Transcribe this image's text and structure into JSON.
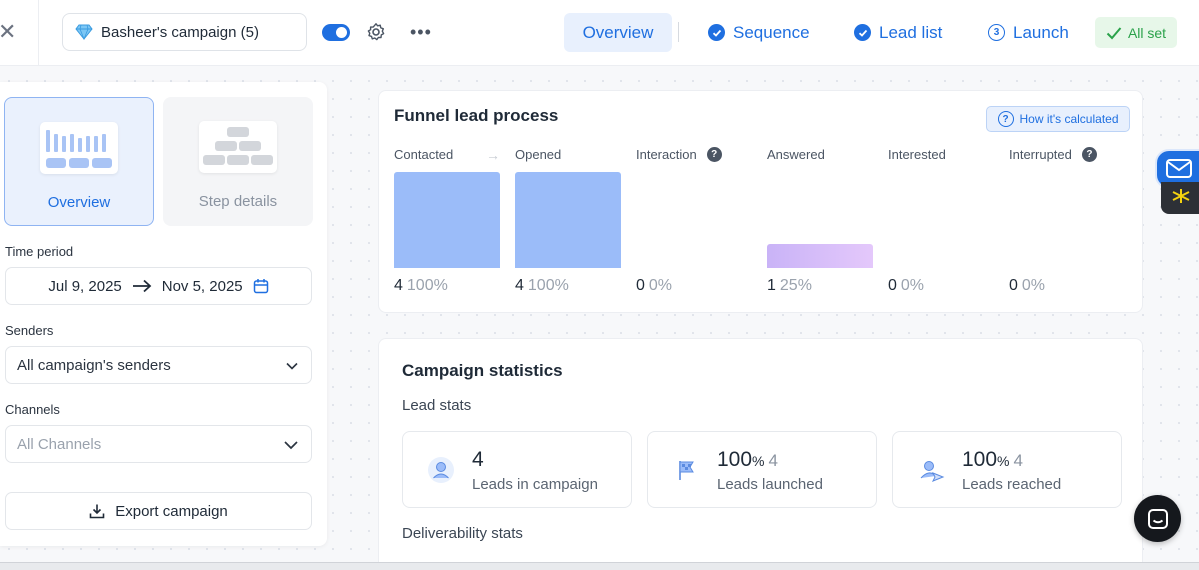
{
  "header": {
    "campaign_name": "Basheer's campaign (5)",
    "tabs": [
      {
        "label": "Overview",
        "state": "active"
      },
      {
        "label": "Sequence",
        "state": "done"
      },
      {
        "label": "Lead list",
        "state": "done"
      },
      {
        "label": "Launch",
        "state": "step",
        "step_number": "3"
      }
    ],
    "status_label": "All set",
    "toggle_on": true
  },
  "sidebar": {
    "views": [
      {
        "label": "Overview",
        "selected": true
      },
      {
        "label": "Step details",
        "selected": false
      }
    ],
    "time_period": {
      "label": "Time period",
      "start": "Jul 9, 2025",
      "end": "Nov 5, 2025"
    },
    "senders": {
      "label": "Senders",
      "value": "All campaign's senders"
    },
    "channels": {
      "label": "Channels",
      "placeholder": "All Channels"
    },
    "export_label": "Export campaign"
  },
  "funnel": {
    "title": "Funnel lead process",
    "how_label": "How it's calculated",
    "chart_data": {
      "type": "bar",
      "categories": [
        "Contacted",
        "Opened",
        "Interaction",
        "Answered",
        "Interested",
        "Interrupted"
      ],
      "values": [
        4,
        4,
        0,
        1,
        0,
        0
      ],
      "percentages": [
        "100%",
        "100%",
        "0%",
        "25%",
        "0%",
        "0%"
      ],
      "value_labels": [
        "4",
        "4",
        "0",
        "1",
        "0",
        "0"
      ],
      "ylim": [
        0,
        4
      ],
      "colors": [
        "#9bbcf9",
        "#9bbcf9",
        "#9bbcf9",
        "#d9bff9",
        "#9bbcf9",
        "#9bbcf9"
      ],
      "help_icons": [
        "Interaction",
        "Interrupted"
      ]
    }
  },
  "stats": {
    "title": "Campaign statistics",
    "lead_stats_label": "Lead stats",
    "deliverability_label": "Deliverability stats",
    "boxes": [
      {
        "icon": "user-icon",
        "value": "4",
        "unit": "",
        "sub": "",
        "label": "Leads in campaign"
      },
      {
        "icon": "flag-icon",
        "value": "100",
        "unit": "%",
        "sub": "4",
        "label": "Leads launched"
      },
      {
        "icon": "user-send-icon",
        "value": "100",
        "unit": "%",
        "sub": "4",
        "label": "Leads reached"
      }
    ]
  },
  "colors": {
    "accent": "#1f6fe0",
    "success": "#2aa24a",
    "bar_blue": "#9bbcf9",
    "bar_purple": "#d9bff9"
  }
}
